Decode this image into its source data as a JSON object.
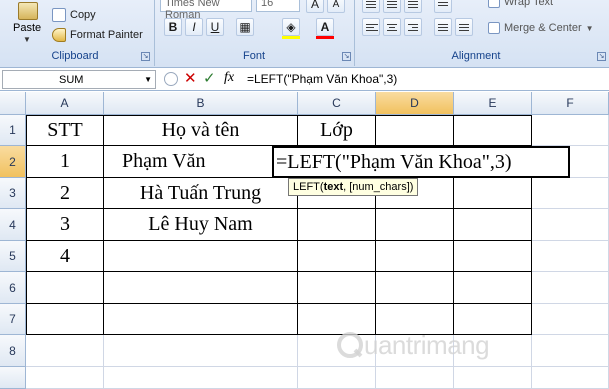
{
  "ribbon": {
    "clipboard": {
      "paste": "Paste",
      "copy": "Copy",
      "format_painter": "Format Painter",
      "label": "Clipboard"
    },
    "font": {
      "font_name": "Times New Roman",
      "font_size": "16",
      "bold": "B",
      "italic": "I",
      "underline": "U",
      "grow": "A",
      "shrink": "A",
      "label": "Font"
    },
    "alignment": {
      "wrap_text": "Wrap Text",
      "merge_center": "Merge & Center",
      "label": "Alignment"
    }
  },
  "formula_bar": {
    "name_box": "SUM",
    "fx": "fx",
    "formula": "=LEFT(\"Phạm Văn Khoa\",3)"
  },
  "columns": [
    "A",
    "B",
    "C",
    "D",
    "E",
    "F"
  ],
  "rows": [
    "1",
    "2",
    "3",
    "4",
    "5",
    "6",
    "7",
    "8"
  ],
  "cells": {
    "A1": "STT",
    "B1": "Họ và tên",
    "C1": "Lớp",
    "A2": "1",
    "B2": "Phạm Văn",
    "C2": "=LEFT(\"Phạm Văn Khoa\",3)",
    "A3": "2",
    "B3": "Hà Tuấn Trung",
    "A4": "3",
    "B4": "Lê Huy Nam",
    "A5": "4"
  },
  "tooltip": {
    "func": "LEFT(",
    "arg1": "text",
    "rest": ", [num_chars])"
  },
  "watermark": "uantrimang"
}
